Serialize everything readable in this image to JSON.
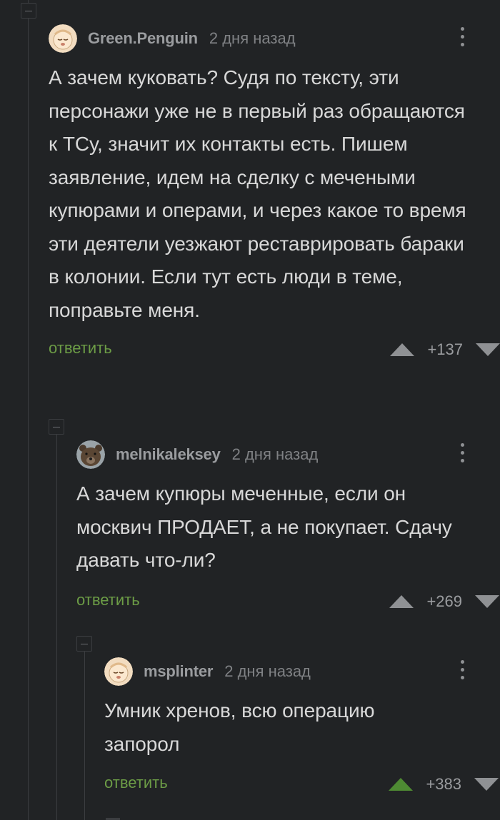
{
  "comments": [
    {
      "author": "Green.Penguin",
      "time": "2 дня назад",
      "text": "А зачем куковать? Судя по тексту, эти персонажи уже не в первый раз обращаются к ТСу, значит их контакты есть. Пишем заявление, идем на сделку с мечеными купюрами и операми, и через какое то время эти деятели уезжают реставрировать бараки в колонии. Если тут есть люди в теме, поправьте меня.",
      "reply_label": "ответить",
      "score": "+137",
      "upvoted": false
    },
    {
      "author": "melnikaleksey",
      "time": "2 дня назад",
      "text": "А зачем купюры меченные, если он москвич ПРОДАЕТ, а не покупает. Сдачу давать что-ли?",
      "reply_label": "ответить",
      "score": "+269",
      "upvoted": false
    },
    {
      "author": "msplinter",
      "time": "2 дня назад",
      "text": "Умник хренов, всю операцию запорол",
      "reply_label": "ответить",
      "score": "+383",
      "upvoted": true
    }
  ],
  "colors": {
    "background": "#212325",
    "reply": "#6c9c46",
    "upvote_active": "#4e8a33",
    "vote_inactive": "#8f9194"
  },
  "icons": {
    "avatar_default": "sleepy-face-avatar",
    "avatar_bear": "bear-photo-avatar",
    "menu": "vertical-dots-icon",
    "vote_up": "triangle-up-icon",
    "vote_down": "triangle-down-icon",
    "collapse": "minus-box-icon"
  }
}
